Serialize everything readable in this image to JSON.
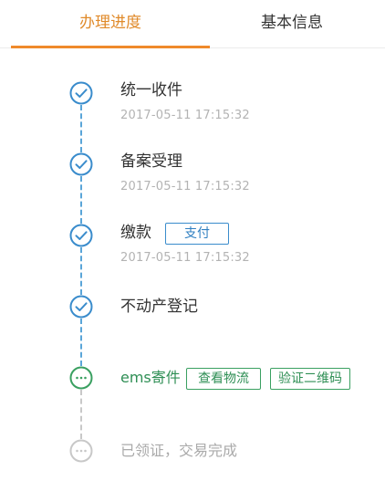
{
  "tabs": {
    "progress_label": "办理进度",
    "info_label": "基本信息"
  },
  "steps": [
    {
      "title": "统一收件",
      "time": "2017-05-11 17:15:32",
      "status": "done"
    },
    {
      "title": "备案受理",
      "time": "2017-05-11 17:15:32",
      "status": "done"
    },
    {
      "title": "缴款",
      "time": "2017-05-11 17:15:32",
      "status": "done",
      "action": "支付"
    },
    {
      "title": "不动产登记",
      "status": "done"
    },
    {
      "title": "ems寄件",
      "status": "in-progress",
      "actions": [
        "查看物流",
        "验证二维码"
      ]
    },
    {
      "title": "已领证，交易完成",
      "status": "pending"
    }
  ],
  "colors": {
    "accent": "#ef8a2b",
    "done": "#3a8ccc",
    "in_progress": "#3aa061",
    "pending": "#c8c8c8"
  },
  "icons": {
    "done": "check-circle-icon",
    "in_progress": "ellipsis-circle-icon",
    "pending": "ellipsis-circle-icon"
  }
}
